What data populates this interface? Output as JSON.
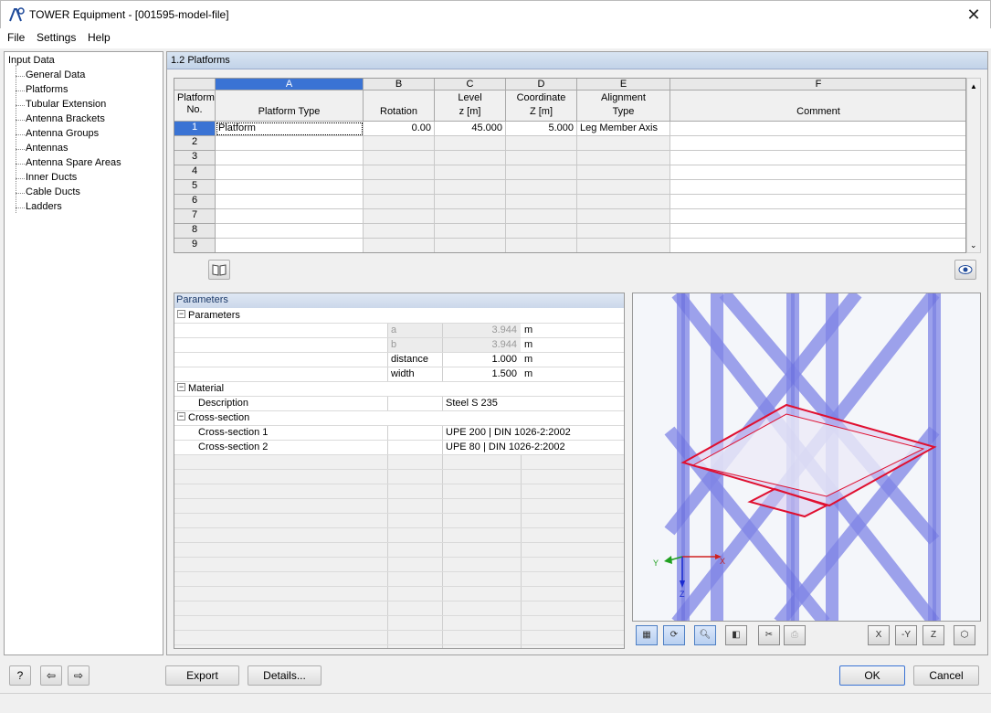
{
  "window": {
    "title": "TOWER Equipment - [001595-model-file]"
  },
  "menu": [
    "File",
    "Settings",
    "Help"
  ],
  "tree": {
    "root": "Input Data",
    "items": [
      "General Data",
      "Platforms",
      "Tubular Extension",
      "Antenna Brackets",
      "Antenna Groups",
      "Antennas",
      "Antenna Spare Areas",
      "Inner Ducts",
      "Cable Ducts",
      "Ladders"
    ]
  },
  "section_title": "1.2 Platforms",
  "table": {
    "letters": [
      "A",
      "B",
      "C",
      "D",
      "E",
      "F"
    ],
    "corner": [
      "Platform",
      "No."
    ],
    "headers": [
      [
        "",
        "Platform Type"
      ],
      [
        "",
        "Rotation"
      ],
      [
        "Level",
        "z [m]"
      ],
      [
        "Coordinate",
        "Z [m]"
      ],
      [
        "Alignment",
        "Type"
      ],
      [
        "",
        "Comment"
      ]
    ],
    "rows": [
      {
        "no": "1",
        "cells": [
          "Platform",
          "0.00",
          "45.000",
          "5.000",
          "Leg Member Axis",
          ""
        ]
      },
      {
        "no": "2",
        "cells": [
          "",
          "",
          "",
          "",
          "",
          ""
        ]
      },
      {
        "no": "3",
        "cells": [
          "",
          "",
          "",
          "",
          "",
          ""
        ]
      },
      {
        "no": "4",
        "cells": [
          "",
          "",
          "",
          "",
          "",
          ""
        ]
      },
      {
        "no": "5",
        "cells": [
          "",
          "",
          "",
          "",
          "",
          ""
        ]
      },
      {
        "no": "6",
        "cells": [
          "",
          "",
          "",
          "",
          "",
          ""
        ]
      },
      {
        "no": "7",
        "cells": [
          "",
          "",
          "",
          "",
          "",
          ""
        ]
      },
      {
        "no": "8",
        "cells": [
          "",
          "",
          "",
          "",
          "",
          ""
        ]
      },
      {
        "no": "9",
        "cells": [
          "",
          "",
          "",
          "",
          "",
          ""
        ]
      }
    ]
  },
  "params": {
    "title": "Parameters",
    "group_parameters": "Parameters",
    "param_rows": [
      {
        "name": "a",
        "value": "3.944",
        "unit": "m",
        "disabled": true
      },
      {
        "name": "b",
        "value": "3.944",
        "unit": "m",
        "disabled": true
      },
      {
        "name": "distance",
        "value": "1.000",
        "unit": "m",
        "disabled": false
      },
      {
        "name": "width",
        "value": "1.500",
        "unit": "m",
        "disabled": false
      }
    ],
    "group_material": "Material",
    "material_label": "Description",
    "material_value": "Steel S 235",
    "group_cross": "Cross-section",
    "cross_rows": [
      {
        "label": "Cross-section 1",
        "value": "UPE 200 | DIN 1026-2:2002"
      },
      {
        "label": "Cross-section 2",
        "value": "UPE 80 | DIN 1026-2:2002"
      }
    ]
  },
  "axes": {
    "x": "X",
    "y": "Y",
    "z": "Z"
  },
  "view_toolbar_icons": [
    "display-icon",
    "rotate-icon",
    "zoom-icon",
    "render-icon",
    "section-icon",
    "print-icon",
    "view-x-icon",
    "view-y-icon",
    "view-z-icon",
    "view-iso-icon"
  ],
  "view_axis_labels": {
    "x": "X",
    "y": "-Y",
    "z": "Z"
  },
  "buttons": {
    "export": "Export",
    "details": "Details...",
    "ok": "OK",
    "cancel": "Cancel"
  },
  "colors": {
    "selection": "#3a73d4",
    "tower": "#7b7fe0",
    "platform": "#e01030"
  }
}
